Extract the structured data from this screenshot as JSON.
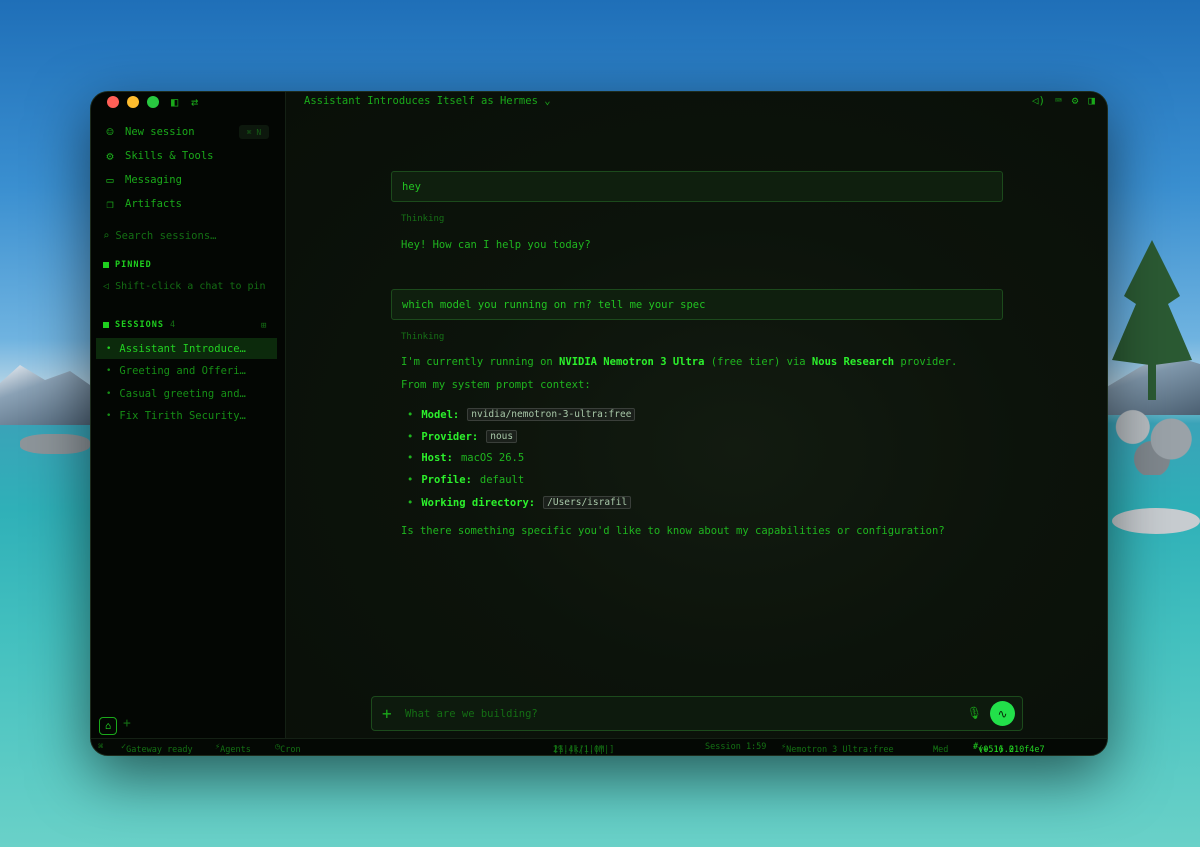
{
  "window": {
    "title": "Assistant Introduces Itself as Hermes",
    "title_chevron": "⌄"
  },
  "sidebar": {
    "nav": [
      {
        "label": "New session",
        "icon": "new-session-icon",
        "shortcut": "⌘ N"
      },
      {
        "label": "Skills & Tools",
        "icon": "skills-icon"
      },
      {
        "label": "Messaging",
        "icon": "chat-bubble-icon"
      },
      {
        "label": "Artifacts",
        "icon": "document-icon"
      }
    ],
    "search_placeholder": "Search sessions…",
    "pinned": {
      "heading": "PINNED",
      "hint": "Shift-click a chat to pin"
    },
    "sessions": {
      "heading": "SESSIONS",
      "count": "4",
      "items": [
        {
          "label": "Assistant Introduce…",
          "active": true
        },
        {
          "label": "Greeting and Offeri…",
          "active": false
        },
        {
          "label": "Casual greeting and…",
          "active": false
        },
        {
          "label": "Fix Tirith Security…",
          "active": false
        }
      ]
    }
  },
  "conversation": {
    "thinking_label": "Thinking",
    "m1_user": "hey",
    "m1_reply": "Hey! How can I help you today?",
    "m2_user": "which model you running on rn? tell me your spec",
    "m2_reply": {
      "p1_pre": "I'm currently running on ",
      "p1_model": "NVIDIA Nemotron 3 Ultra",
      "p1_mid": " (free tier) via ",
      "p1_provider": "Nous Research",
      "p1_post": " provider.",
      "p2": "From my system prompt context:",
      "specs": [
        {
          "label": "Model:",
          "value": "nvidia/nemotron-3-ultra:free",
          "code": true
        },
        {
          "label": "Provider:",
          "value": "nous",
          "code": true
        },
        {
          "label": "Host:",
          "value": "macOS 26.5",
          "code": false
        },
        {
          "label": "Profile:",
          "value": "default",
          "code": false
        },
        {
          "label": "Working directory:",
          "value": "/Users/israfil",
          "code": true
        }
      ],
      "closing": "Is there something specific you'd like to know about my capabilities or configuration?"
    }
  },
  "composer": {
    "placeholder": "What are we building?"
  },
  "statusbar": {
    "gateway": "Gateway ready",
    "agents": "Agents",
    "cron": "Cron",
    "tokens": "17.4k/1.0M",
    "meter": "[||||||||||]",
    "percent": "2%",
    "session_time": "Session 1:59",
    "model": "Nemotron 3 Ultra:free",
    "effort": "Med",
    "version": "v0.16.0",
    "version_extra": "(+51) 210f4e7"
  },
  "colors": {
    "accent": "#22d022",
    "send_button": "#22e04a"
  }
}
